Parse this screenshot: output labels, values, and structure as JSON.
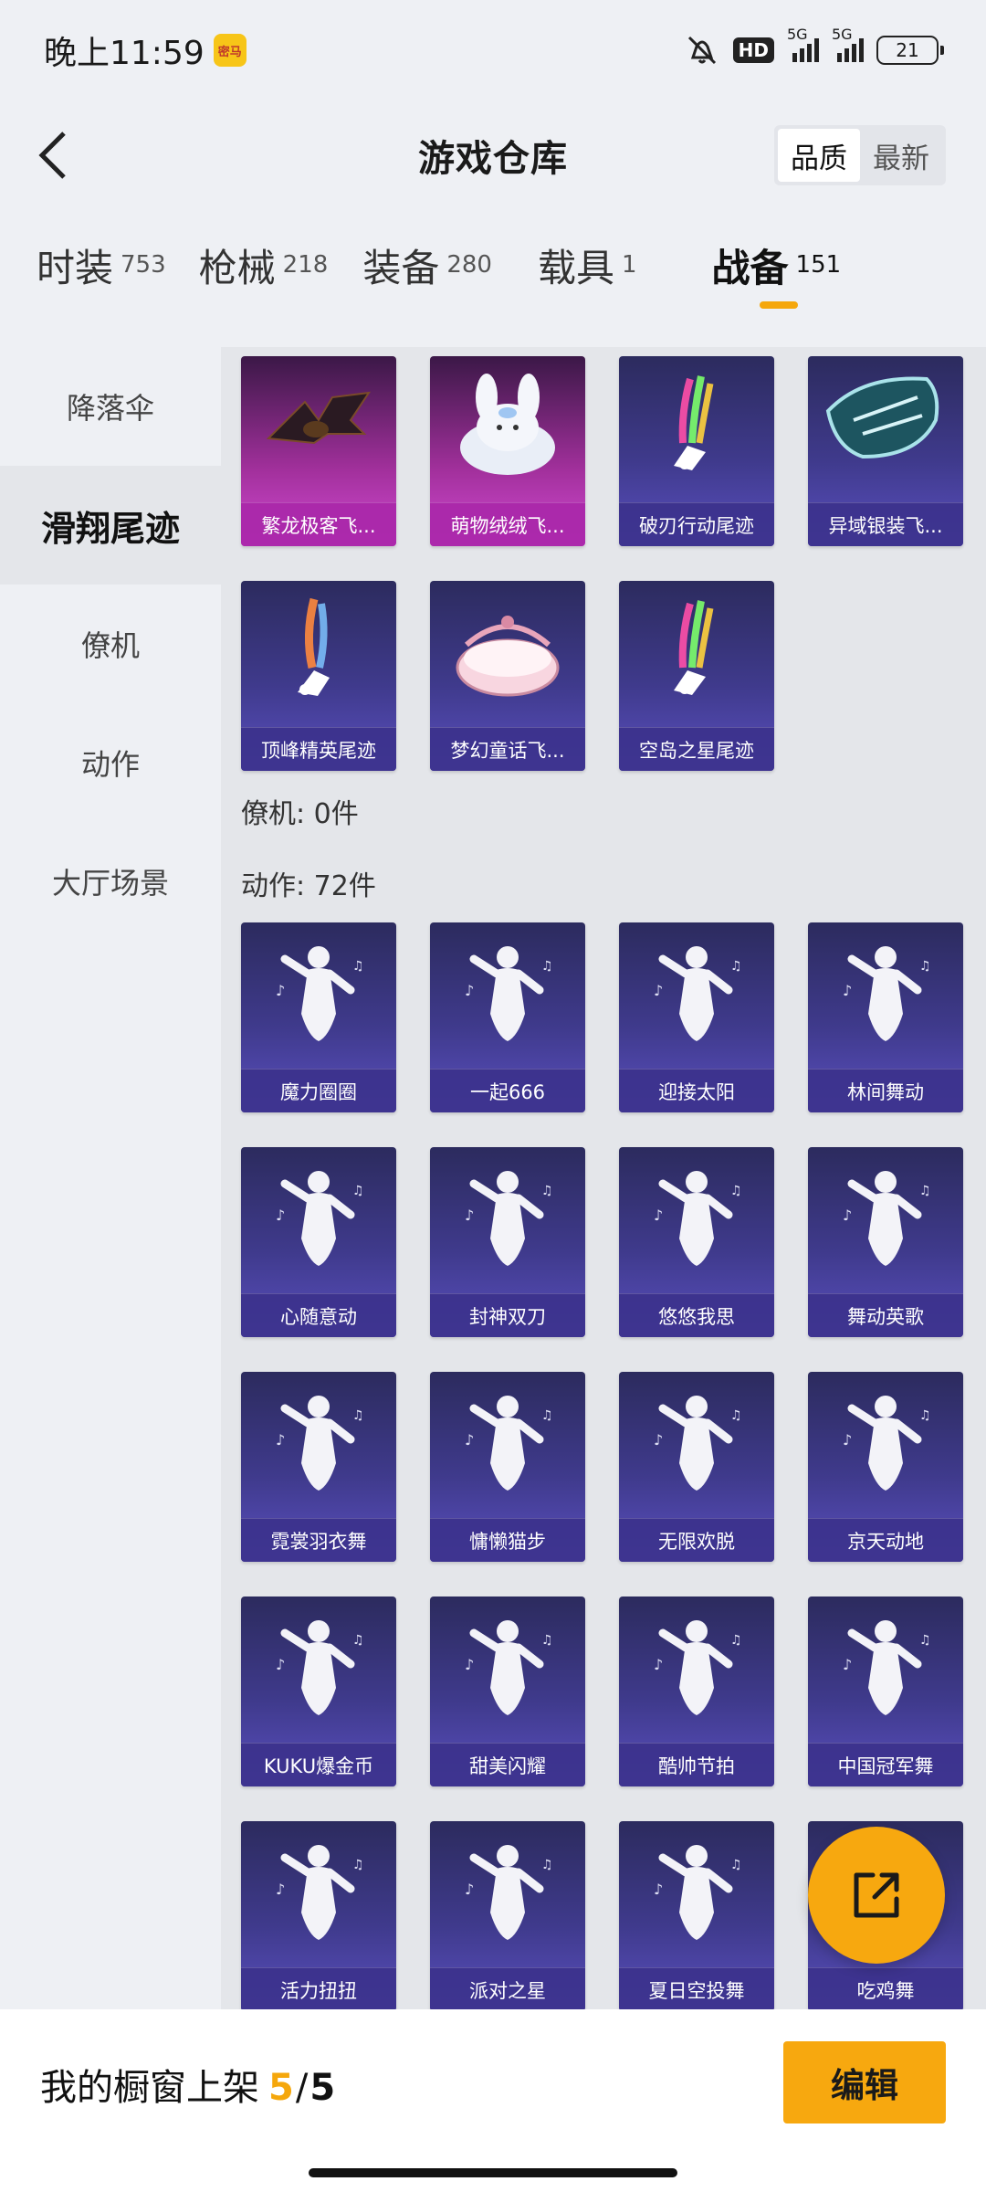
{
  "status_bar": {
    "time": "晚上11:59",
    "app_badge": "密马",
    "hd": "HD",
    "net1": "5G",
    "net2": "5G",
    "battery": "21"
  },
  "header": {
    "title": "游戏仓库",
    "sort_options": [
      "品质",
      "最新"
    ]
  },
  "tabs": [
    {
      "label": "时装",
      "count": "753"
    },
    {
      "label": "枪械",
      "count": "218"
    },
    {
      "label": "装备",
      "count": "280"
    },
    {
      "label": "载具",
      "count": "1"
    },
    {
      "label": "战备",
      "count": "151"
    }
  ],
  "sidebar": {
    "items": [
      "降落伞",
      "滑翔尾迹",
      "僚机",
      "动作",
      "大厅场景"
    ]
  },
  "content": {
    "trails": [
      {
        "name": "繁龙极客飞...",
        "style": "purple",
        "icon": "dragon-wings"
      },
      {
        "name": "萌物绒绒飞...",
        "style": "purple",
        "icon": "bunny-plush"
      },
      {
        "name": "破刃行动尾迹",
        "style": "blue",
        "icon": "rainbow-trail"
      },
      {
        "name": "异域银装飞...",
        "style": "blue",
        "icon": "silver-wings"
      },
      {
        "name": "顶峰精英尾迹",
        "style": "blue",
        "icon": "fire-trail"
      },
      {
        "name": "梦幻童话飞...",
        "style": "blue",
        "icon": "fairy-drum"
      },
      {
        "name": "空岛之星尾迹",
        "style": "blue",
        "icon": "rainbow-trail"
      }
    ],
    "wingman_section": "僚机: 0件",
    "actions_section": "动作: 72件",
    "actions": [
      {
        "name": "魔力圈圈"
      },
      {
        "name": "一起666"
      },
      {
        "name": "迎接太阳"
      },
      {
        "name": "林间舞动"
      },
      {
        "name": "心随意动"
      },
      {
        "name": "封神双刀"
      },
      {
        "name": "悠悠我思"
      },
      {
        "name": "舞动英歌"
      },
      {
        "name": "霓裳羽衣舞"
      },
      {
        "name": "慵懒猫步"
      },
      {
        "name": "无限欢脱"
      },
      {
        "name": "京天动地"
      },
      {
        "name": "KUKU爆金币"
      },
      {
        "name": "甜美闪耀"
      },
      {
        "name": "酷帅节拍"
      },
      {
        "name": "中国冠军舞"
      },
      {
        "name": "活力扭扭"
      },
      {
        "name": "派对之星"
      },
      {
        "name": "夏日空投舞"
      },
      {
        "name": "吃鸡舞"
      }
    ]
  },
  "bottom_bar": {
    "showcase_label": "我的橱窗上架",
    "showcase_used": "5",
    "showcase_sep": "/",
    "showcase_total": "5",
    "edit_label": "编辑"
  },
  "colors": {
    "accent": "#f7a80f",
    "card_blue": "#3f3a8c",
    "card_purple": "#a2309c"
  }
}
